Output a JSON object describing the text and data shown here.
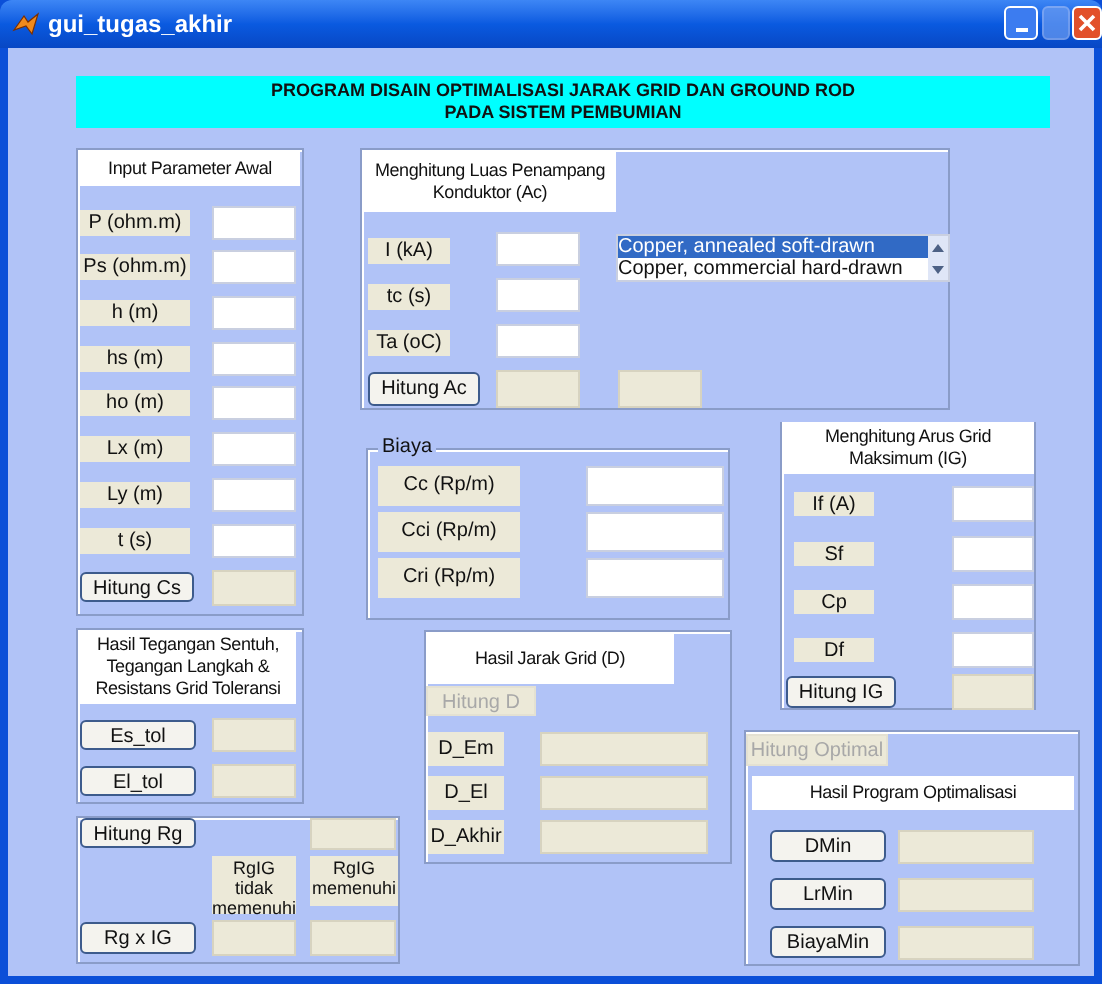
{
  "window": {
    "title": "gui_tugas_akhir"
  },
  "banner": [
    "PROGRAM DISAIN OPTIMALISASI JARAK GRID DAN GROUND ROD",
    "PADA SISTEM PEMBUMIAN"
  ],
  "input_panel": {
    "title": "Input Parameter Awal",
    "rows": [
      {
        "label": "P (ohm.m)"
      },
      {
        "label": "Ps (ohm.m)"
      },
      {
        "label": "h (m)"
      },
      {
        "label": "hs (m)"
      },
      {
        "label": "ho (m)"
      },
      {
        "label": "Lx (m)"
      },
      {
        "label": "Ly (m)"
      },
      {
        "label": "t (s)"
      }
    ],
    "button": {
      "label": "Hitung Cs",
      "disabled": false
    }
  },
  "conductor_panel": {
    "title": "Menghitung Luas Penampang Konduktor (Ac)",
    "rows": [
      {
        "label": "I (kA)"
      },
      {
        "label": "tc (s)"
      },
      {
        "label": "Ta (oC)"
      }
    ],
    "materials": [
      {
        "label": "Copper, annealed soft-drawn",
        "selected": true
      },
      {
        "label": "Copper, commercial hard-drawn",
        "selected": false
      }
    ],
    "button": {
      "label": "Hitung Ac",
      "disabled": false
    }
  },
  "cost_panel": {
    "title": "Biaya",
    "rows": [
      {
        "label": "Cc (Rp/m)"
      },
      {
        "label": "Cci (Rp/m)"
      },
      {
        "label": "Cri (Rp/m)"
      }
    ]
  },
  "grid_current_panel": {
    "title": "Menghitung Arus Grid Maksimum (IG)",
    "rows": [
      {
        "label": "If (A)"
      },
      {
        "label": "Sf"
      },
      {
        "label": "Cp"
      },
      {
        "label": "Df"
      }
    ],
    "button": {
      "label": "Hitung IG",
      "disabled": false
    }
  },
  "tolerance_panel": {
    "title": "Hasil Tegangan Sentuh, Tegangan Langkah & Resistans Grid Toleransi",
    "buttons": [
      {
        "label": "Es_tol",
        "disabled": false
      },
      {
        "label": "El_tol",
        "disabled": false
      }
    ]
  },
  "rg_panel": {
    "button": {
      "label": "Hitung Rg",
      "disabled": false
    },
    "headers": [
      "RgIG tidak memenuhi",
      "RgIG memenuhi"
    ],
    "result_button": {
      "label": "Rg x IG",
      "disabled": false
    }
  },
  "grid_distance_panel": {
    "title": "Hasil Jarak Grid (D)",
    "button": {
      "label": "Hitung D",
      "disabled": true
    },
    "rows": [
      {
        "label": "D_Em"
      },
      {
        "label": "D_El"
      },
      {
        "label": "D_Akhir"
      }
    ]
  },
  "optimization_panel": {
    "button": {
      "label": "Hitung Optimal",
      "disabled": true
    },
    "title": "Hasil Program Optimalisasi",
    "buttons": [
      {
        "label": "DMin",
        "disabled": false
      },
      {
        "label": "LrMin",
        "disabled": false
      },
      {
        "label": "BiayaMin",
        "disabled": false
      }
    ]
  }
}
